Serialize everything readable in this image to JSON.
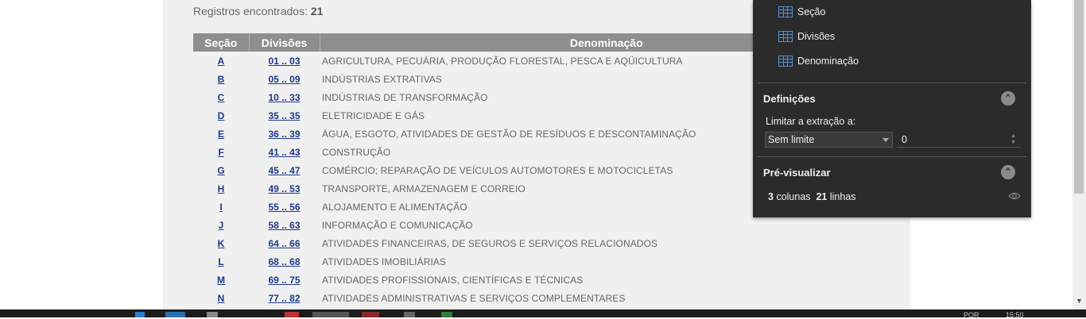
{
  "records": {
    "label": "Registros encontrados:",
    "count": "21"
  },
  "table": {
    "headers": [
      "Seção",
      "Divisões",
      "Denominação"
    ],
    "rows": [
      {
        "secao": "A",
        "divisoes": "01 .. 03",
        "denominacao": "AGRICULTURA, PECUÁRIA, PRODUÇÃO FLORESTAL, PESCA E AQÜICULTURA"
      },
      {
        "secao": "B",
        "divisoes": "05 .. 09",
        "denominacao": "INDÚSTRIAS EXTRATIVAS"
      },
      {
        "secao": "C",
        "divisoes": "10 .. 33",
        "denominacao": "INDÚSTRIAS DE TRANSFORMAÇÃO"
      },
      {
        "secao": "D",
        "divisoes": "35 .. 35",
        "denominacao": "ELETRICIDADE E GÁS"
      },
      {
        "secao": "E",
        "divisoes": "36 .. 39",
        "denominacao": "ÁGUA, ESGOTO, ATIVIDADES DE GESTÃO DE RESÍDUOS E DESCONTAMINAÇÃO"
      },
      {
        "secao": "F",
        "divisoes": "41 .. 43",
        "denominacao": "CONSTRUÇÃO"
      },
      {
        "secao": "G",
        "divisoes": "45 .. 47",
        "denominacao": "COMÉRCIO; REPARAÇÃO DE VEÍCULOS AUTOMOTORES E MOTOCICLETAS"
      },
      {
        "secao": "H",
        "divisoes": "49 .. 53",
        "denominacao": "TRANSPORTE, ARMAZENAGEM E CORREIO"
      },
      {
        "secao": "I",
        "divisoes": "55 .. 56",
        "denominacao": "ALOJAMENTO E ALIMENTAÇÃO"
      },
      {
        "secao": "J",
        "divisoes": "58 .. 63",
        "denominacao": "INFORMAÇÃO E COMUNICAÇÃO"
      },
      {
        "secao": "K",
        "divisoes": "64 .. 66",
        "denominacao": "ATIVIDADES FINANCEIRAS, DE SEGUROS E SERVIÇOS RELACIONADOS"
      },
      {
        "secao": "L",
        "divisoes": "68 .. 68",
        "denominacao": "ATIVIDADES IMOBILIÁRIAS"
      },
      {
        "secao": "M",
        "divisoes": "69 .. 75",
        "denominacao": "ATIVIDADES PROFISSIONAIS, CIENTÍFICAS E TÉCNICAS"
      },
      {
        "secao": "N",
        "divisoes": "77 .. 82",
        "denominacao": "ATIVIDADES ADMINISTRATIVAS E SERVIÇOS COMPLEMENTARES"
      }
    ]
  },
  "panel": {
    "columns": [
      "Seção",
      "Divisões",
      "Denominação"
    ],
    "definitions": {
      "title": "Definições",
      "limit_label": "Limitar a extração a:",
      "limit_option": "Sem limite",
      "limit_value": "0"
    },
    "preview": {
      "title": "Pré-visualizar",
      "columns_count": "3",
      "columns_word": "colunas",
      "rows_count": "21",
      "rows_word": "linhas"
    }
  },
  "taskbar": {
    "language": "POR",
    "time": "15:50"
  },
  "colors": {
    "link": "#1f3a8a",
    "header_bg": "#8e8e8e",
    "panel_bg": "#2b2b2b",
    "icon_blue": "#5a8fd6"
  }
}
